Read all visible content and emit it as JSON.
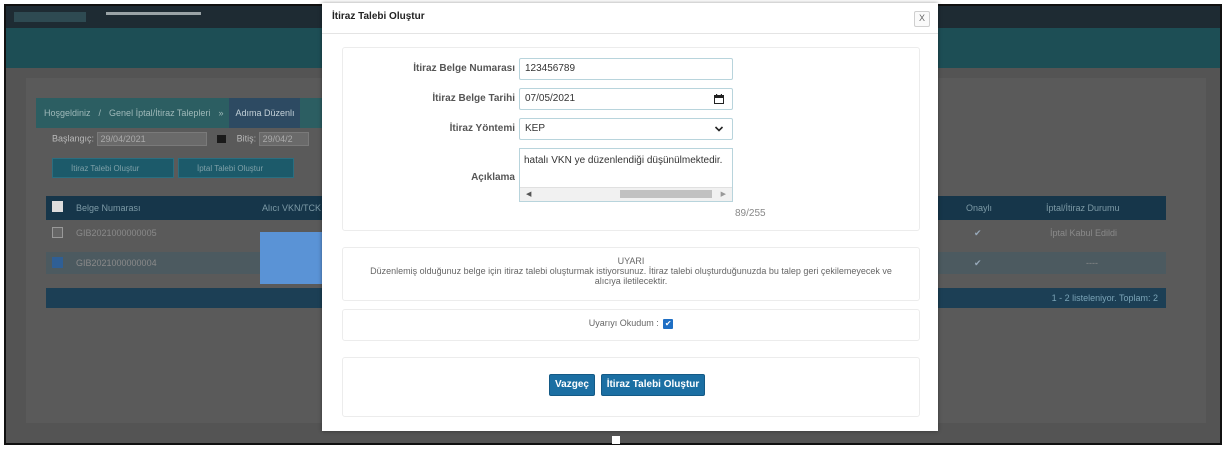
{
  "background": {
    "breadcrumb": {
      "item1": "Hoşgeldiniz",
      "item2": "Genel İptal/İtiraz Talepleri",
      "active": "Adıma Düzenlı"
    },
    "filters": {
      "start_label": "Başlangıç",
      "start_value": "29/04/2021",
      "end_label": "Bitiş",
      "end_value": "29/04/2"
    },
    "buttons": {
      "objection": "İtiraz Talebi Oluştur",
      "cancel": "İptal Talebi Oluştur"
    },
    "table": {
      "headers": [
        "Belge Numarası",
        "Alıcı VKN/TCK",
        "Onaylı",
        "İptal/İtiraz Durumu"
      ],
      "rows": [
        {
          "number": "GIB2021000000005",
          "status": "İptal Kabul Edildi",
          "checked": false
        },
        {
          "number": "GIB2021000000004",
          "status": "----",
          "checked": true
        }
      ],
      "footer": "1 - 2 listeleniyor. Toplam: 2"
    }
  },
  "modal": {
    "title": "İtiraz Talebi Oluştur",
    "close": "X",
    "fields": {
      "doc_number_label": "İtiraz Belge Numarası",
      "doc_number_value": "123456789",
      "doc_date_label": "İtiraz Belge Tarihi",
      "doc_date_value": "07/05/2021",
      "method_label": "İtiraz Yöntemi",
      "method_value": "KEP",
      "description_label": "Açıklama",
      "description_value": "hatalı VKN ye düzenlendiği düşünülmektedir.",
      "char_counter": "89/255"
    },
    "warning": {
      "title": "UYARI",
      "text": "Düzenlemiş olduğunuz belge için itiraz talebi oluşturmak istiyorsunuz. İtiraz talebi oluşturduğunuzda bu talep geri çekilemeyecek ve alıcıya iletilecektir."
    },
    "acknowledge_label": "Uyarıyı Okudum",
    "acknowledge_checked": true,
    "actions": {
      "cancel": "Vazgeç",
      "submit": "İtiraz Talebi Oluştur"
    }
  }
}
